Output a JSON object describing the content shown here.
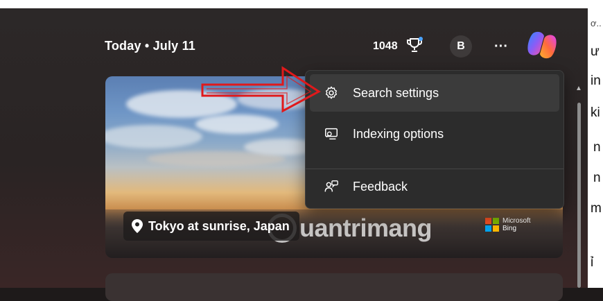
{
  "header": {
    "date_label": "Today  •  July 11",
    "points": "1048",
    "avatar_initial": "B",
    "more_label": "···"
  },
  "hero": {
    "location": "Tokyo at sunrise, Japan",
    "brand_line1": "Microsoft",
    "brand_line2": "Bing",
    "watermark": "uantrimang"
  },
  "menu": {
    "items": [
      {
        "label": "Search settings",
        "icon": "gear-icon"
      },
      {
        "label": "Indexing options",
        "icon": "search-monitor-icon"
      },
      {
        "label": "Feedback",
        "icon": "feedback-icon"
      }
    ]
  },
  "right_page": {
    "lines": [
      "ơ..",
      "ư",
      "in",
      "ki",
      "n",
      "n",
      "m",
      "ỉ"
    ]
  },
  "colors": {
    "menu_bg": "#2c2c2c",
    "annotation_arrow": "#e0191b",
    "bing_red": "#f25022",
    "bing_green": "#7fba00",
    "bing_blue": "#00a4ef",
    "bing_yellow": "#ffb900"
  }
}
